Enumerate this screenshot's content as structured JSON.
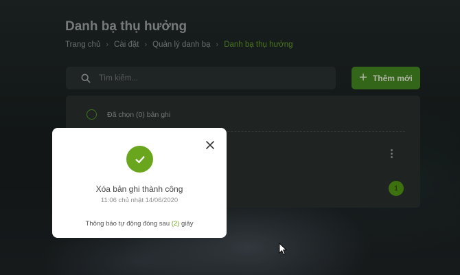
{
  "page": {
    "title": "Danh bạ thụ hưởng",
    "breadcrumb": [
      "Trang chủ",
      "Cài đặt",
      "Quản lý danh bạ",
      "Danh bạ thụ hưởng"
    ],
    "breadcrumb_separator": "›"
  },
  "search": {
    "placeholder": "Tìm kiếm...",
    "value": "",
    "icon": "search-icon"
  },
  "toolbar": {
    "add_icon": "+",
    "add_label": "Thêm mới"
  },
  "list": {
    "selected_label": "Đã chọn (0) bản ghi",
    "more_icon": "more-vertical-icon"
  },
  "pagination": {
    "current_page": "1"
  },
  "dialog": {
    "message": "Xóa bản ghi thành công",
    "timestamp": "11:06 chủ nhật 14/06/2020",
    "auto_close_prefix": "Thông báo tự động đóng sau",
    "auto_close_count": "(2)",
    "auto_close_suffix": "giây",
    "close_icon": "close-icon",
    "status_icon": "check-circle-icon"
  },
  "colors": {
    "accent": "#6aa51e",
    "button": "#3f7d1e",
    "breadcrumb_active": "#5c8f2a",
    "panel": "#262c2b",
    "background": "#1a1f1e"
  }
}
